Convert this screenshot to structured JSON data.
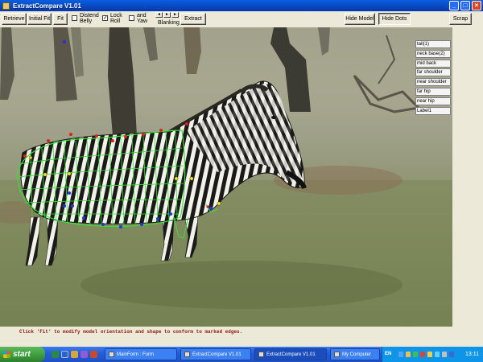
{
  "window": {
    "title": "ExtractCompare V1.01",
    "controls": [
      "_",
      "□",
      "×"
    ]
  },
  "toolbar": {
    "retrieve": "Retrieve",
    "initial_fit": "Initial Fit",
    "fit": "Fit",
    "distend_belly": "Distend Belly",
    "distend_checked": false,
    "lock_roll": "Lock Roll",
    "lock_roll_checked": true,
    "and_yaw": "and Yaw",
    "and_yaw_checked": false,
    "blanking": "Blanking",
    "extract": "Extract",
    "hide_model": "Hide Model",
    "hide_dots": "Hide Dots",
    "scrap": "Scrap"
  },
  "sidebar": {
    "items": [
      "tail(1)",
      "neck base(2)",
      "mid back",
      "far shoulder",
      "near shoulder",
      "far hip",
      "near hip",
      "Label1"
    ]
  },
  "instruction": "Click 'Fit' to modify model orientation and shape to conform to marked edges.",
  "taskbar": {
    "start": "start",
    "tasks": [
      "MainForm : Form",
      "ExtractCompare V1.01",
      "ExtractCompare V1.01",
      "My Computer"
    ],
    "lang": "EN",
    "clock": "13:11"
  },
  "colors": {
    "mesh": "#36e03a",
    "dot_red": "#e0201a",
    "dot_blue": "#2530e0",
    "dot_yellow": "#f4e21c"
  }
}
